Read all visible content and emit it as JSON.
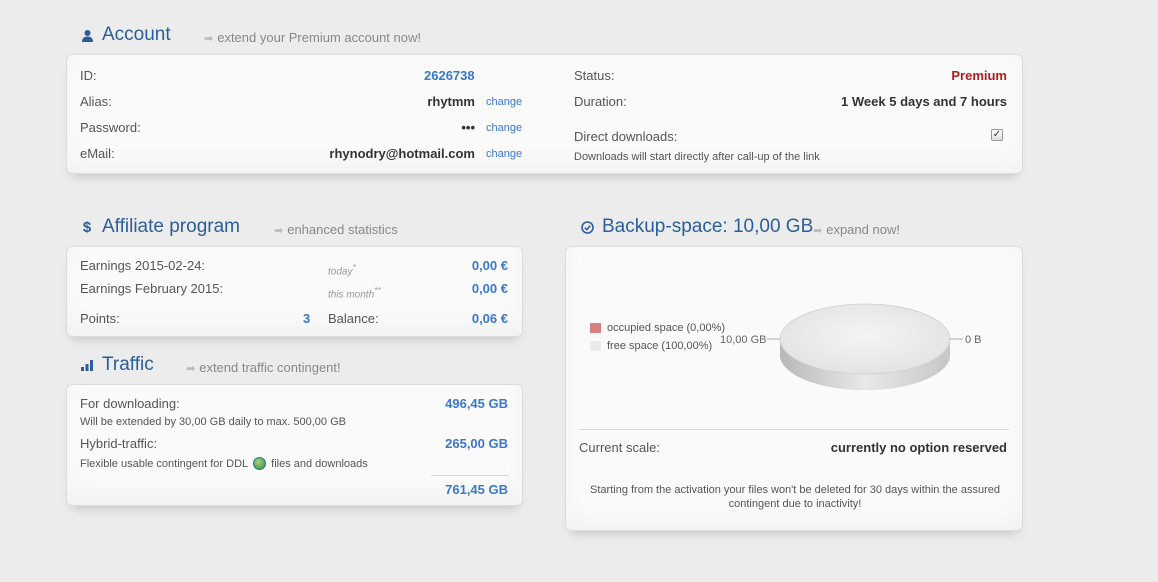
{
  "account": {
    "title": "Account",
    "extend_link": "extend your Premium account now!",
    "id_label": "ID:",
    "id_value": "2626738",
    "alias_label": "Alias:",
    "alias_value": "rhytmm",
    "password_label": "Password:",
    "password_value": "•••",
    "email_label": "eMail:",
    "email_value": "rhynodry@hotmail.com",
    "change_label": "change",
    "status_label": "Status:",
    "status_value": "Premium",
    "duration_label": "Duration:",
    "duration_value": "1 Week 5 days and 7 hours",
    "direct_label": "Direct downloads:",
    "direct_checked": true,
    "direct_desc": "Downloads will start directly after call-up of the link"
  },
  "affiliate": {
    "title": "Affiliate program",
    "link": "enhanced statistics",
    "earnings_day_label": "Earnings 2015-02-24:",
    "today_label": "today",
    "today_mark": "*",
    "earnings_day_value": "0,00 €",
    "earnings_month_label": "Earnings February 2015:",
    "month_label": "this month",
    "month_mark": "**",
    "earnings_month_value": "0,00 €",
    "points_label": "Points:",
    "points_value": "3",
    "balance_label": "Balance:",
    "balance_value": "0,06 €"
  },
  "traffic": {
    "title": "Traffic",
    "link": "extend traffic contingent!",
    "downloading_label": "For downloading:",
    "downloading_value": "496,45 GB",
    "downloading_desc": "Will be extended by 30,00 GB daily to max. 500,00 GB",
    "hybrid_label": "Hybrid-traffic:",
    "hybrid_value": "265,00 GB",
    "hybrid_desc_a": "Flexible usable contingent for DDL",
    "hybrid_desc_b": "files and downloads",
    "total_value": "761,45 GB"
  },
  "backup": {
    "title": "Backup-space: 10,00 GB",
    "link": "expand now!",
    "legend_occupied": "occupied space (0,00%)",
    "legend_free": "free space (100,00%)",
    "pie_left_label": "10,00 GB",
    "pie_right_label": "0 B",
    "scale_label": "Current scale:",
    "scale_value": "currently no option reserved",
    "note": "Starting from the activation your files won't be deleted for 30 days within the assured contingent due to inactivity!",
    "colors": {
      "occupied": "#d98080",
      "free": "#ebebeb"
    }
  },
  "chart_data": {
    "type": "pie",
    "categories": [
      "occupied space (0,00%)",
      "free space (100,00%)"
    ],
    "values": [
      0,
      100
    ]
  }
}
